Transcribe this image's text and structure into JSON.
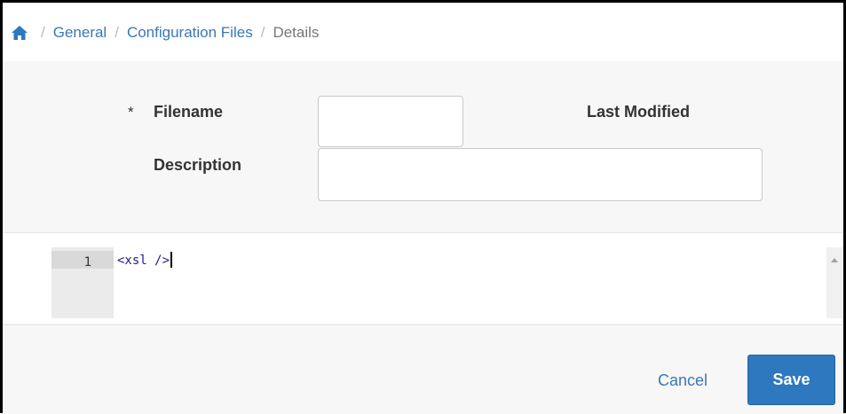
{
  "breadcrumb": {
    "home_icon": "home-icon",
    "items": [
      "General",
      "Configuration Files"
    ],
    "current": "Details",
    "separator": "/"
  },
  "form": {
    "filename": {
      "required_marker": "*",
      "label": "Filename",
      "value": ""
    },
    "last_modified": {
      "label": "Last Modified",
      "value": ""
    },
    "description": {
      "label": "Description",
      "value": ""
    }
  },
  "editor": {
    "lines": [
      {
        "number": "1",
        "text": "<xsl />"
      }
    ]
  },
  "footer": {
    "cancel_label": "Cancel",
    "save_label": "Save"
  },
  "colors": {
    "link": "#3a78b5",
    "primary_button": "#2d78be",
    "code_text": "#1c1c8a"
  }
}
